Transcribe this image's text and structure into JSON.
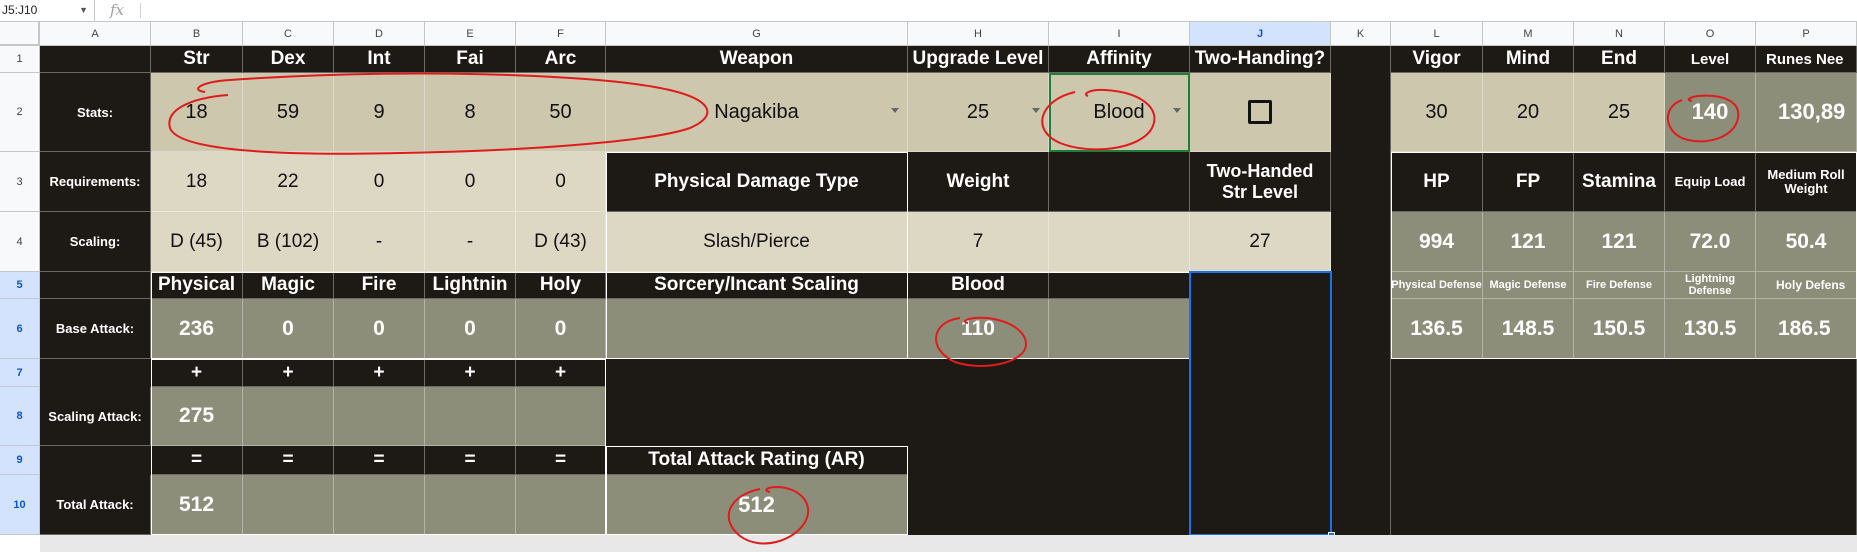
{
  "formula_bar": {
    "name_box": "J5:J10",
    "fx_label": "fx",
    "formula": ""
  },
  "column_headers": [
    "A",
    "B",
    "C",
    "D",
    "E",
    "F",
    "G",
    "H",
    "I",
    "J",
    "K",
    "L",
    "M",
    "N",
    "O",
    "P"
  ],
  "row_headers": [
    "1",
    "2",
    "3",
    "4",
    "5",
    "6",
    "7",
    "8",
    "9",
    "10"
  ],
  "headers": {
    "str": "Str",
    "dex": "Dex",
    "int": "Int",
    "fai": "Fai",
    "arc": "Arc",
    "weapon": "Weapon",
    "upgrade_level": "Upgrade Level",
    "affinity": "Affinity",
    "two_handing": "Two-Handing?",
    "vigor": "Vigor",
    "mind": "Mind",
    "end": "End",
    "level": "Level",
    "runes_needed": "Runes Nee",
    "physical_damage_type": "Physical Damage Type",
    "weight": "Weight",
    "two_handed_str_level": "Two-Handed Str Level",
    "hp": "HP",
    "fp": "FP",
    "stamina": "Stamina",
    "equip_load": "Equip Load",
    "medium_roll_weight": "Medium Roll Weight",
    "physical": "Physical",
    "magic": "Magic",
    "fire": "Fire",
    "lightning": "Lightnin",
    "holy": "Holy",
    "sorcery_incant_scaling": "Sorcery/Incant Scaling",
    "blood": "Blood",
    "physical_defense": "Physical Defense",
    "magic_defense": "Magic Defense",
    "fire_defense": "Fire Defense",
    "lightning_defense": "Lightning Defense",
    "holy_defense": "Holy Defens",
    "total_attack_rating": "Total Attack Rating (AR)"
  },
  "labels": {
    "stats": "Stats:",
    "requirements": "Requirements:",
    "scaling": "Scaling:",
    "base_attack": "Base Attack:",
    "scaling_attack": "Scaling Attack:",
    "total_attack": "Total Attack:"
  },
  "stats": {
    "str": "18",
    "dex": "59",
    "int": "9",
    "fai": "8",
    "arc": "50",
    "weapon": "Nagakiba",
    "upgrade_level": "25",
    "affinity": "Blood",
    "two_handing_checked": false,
    "vigor": "30",
    "mind": "20",
    "end": "25",
    "level": "140",
    "runes_needed": "130,89"
  },
  "requirements": {
    "str": "18",
    "dex": "22",
    "int": "0",
    "fai": "0",
    "arc": "0"
  },
  "scaling": {
    "str": "D (45)",
    "dex": "B (102)",
    "int": "-",
    "fai": "-",
    "arc": "D (43)",
    "physical_damage_type": "Slash/Pierce",
    "weight": "7",
    "two_handed_str_level": "27",
    "hp": "994",
    "fp": "121",
    "stamina": "121",
    "equip_load": "72.0",
    "medium_roll_weight": "50.4"
  },
  "defense": {
    "physical": "136.5",
    "magic": "148.5",
    "fire": "150.5",
    "lightning": "130.5",
    "holy": "186.5"
  },
  "base_attack": {
    "physical": "236",
    "magic": "0",
    "fire": "0",
    "lightning": "0",
    "holy": "0",
    "blood": "110"
  },
  "operators": {
    "plus": "+",
    "equals": "="
  },
  "scaling_attack": {
    "physical": "275"
  },
  "total_attack": {
    "physical": "512",
    "total_ar": "512"
  },
  "colors": {
    "header_dark": "#1d1915",
    "tan": "#cdc7ae",
    "tan_light": "#ddd8c3",
    "olive": "#8d8e7a",
    "annotation_red": "#e01b1b",
    "selection_blue": "#1a73e8"
  }
}
